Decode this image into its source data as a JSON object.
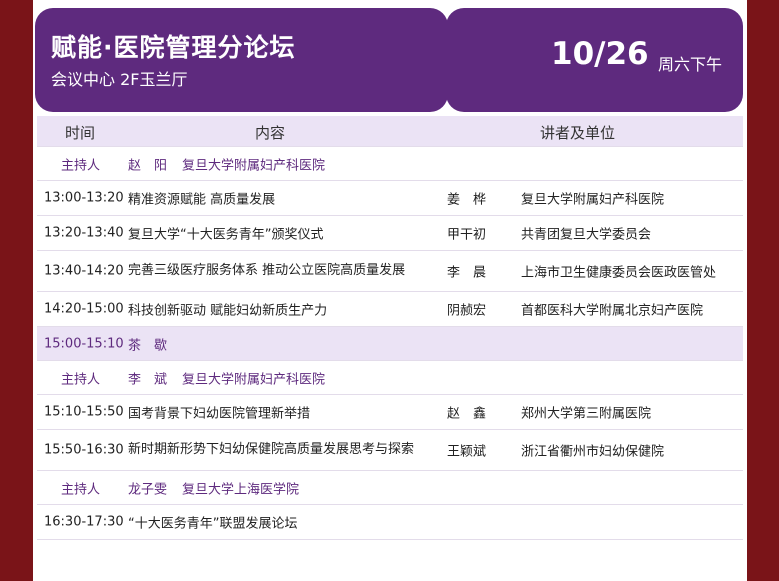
{
  "header": {
    "title": "赋能·医院管理分论坛",
    "venue": "会议中心 2F玉兰厅",
    "date": "10/26",
    "weekday": "周六下午"
  },
  "table": {
    "columns": [
      "时间",
      "内容",
      "讲者及单位"
    ],
    "host_label": "主持人",
    "hosts": [
      {
        "name": "赵　阳",
        "org": "复旦大学附属妇产科医院"
      },
      {
        "name": "李　斌",
        "org": "复旦大学附属妇产科医院"
      },
      {
        "name": "龙子雯",
        "org": "复旦大学上海医学院"
      }
    ],
    "rows": [
      {
        "time": "13:00-13:20",
        "content": "精准资源赋能 高质量发展",
        "speaker": "姜　桦",
        "org": "复旦大学附属妇产科医院"
      },
      {
        "time": "13:20-13:40",
        "content": "复旦大学“十大医务青年”颁奖仪式",
        "speaker": "甲干初",
        "org": "共青团复旦大学委员会"
      },
      {
        "time": "13:40-14:20",
        "content": "完善三级医疗服务体系 推动公立医院高质量发展",
        "speaker": "李　晨",
        "org": "上海市卫生健康委员会医政医管处"
      },
      {
        "time": "14:20-15:00",
        "content": "科技创新驱动 赋能妇幼新质生产力",
        "speaker": "阴赪宏",
        "org": "首都医科大学附属北京妇产医院"
      },
      {
        "time": "15:10-15:50",
        "content": "国考背景下妇幼医院管理新举措",
        "speaker": "赵　鑫",
        "org": "郑州大学第三附属医院"
      },
      {
        "time": "15:50-16:30",
        "content": "新时期新形势下妇幼保健院高质量发展思考与探索",
        "speaker": "王颖斌",
        "org": "浙江省衢州市妇幼保健院"
      },
      {
        "time": "16:30-17:30",
        "content": "“十大医务青年”联盟发展论坛",
        "speaker": "",
        "org": ""
      }
    ],
    "break": {
      "time": "15:00-15:10",
      "label": "茶　歇"
    }
  }
}
